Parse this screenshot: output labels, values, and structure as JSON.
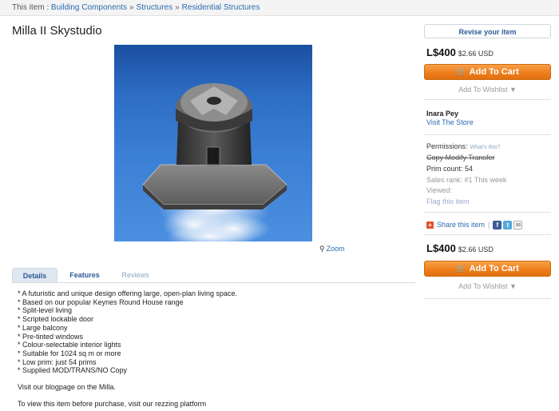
{
  "breadcrumb": {
    "prefix": "This item :",
    "items": [
      "Building Components",
      "Structures",
      "Residential Structures"
    ],
    "separator": "»"
  },
  "product": {
    "title": "Milla II Skystudio",
    "zoom_label": "Zoom"
  },
  "tabs": [
    {
      "label": "Details"
    },
    {
      "label": "Features"
    },
    {
      "label": "Reviews"
    }
  ],
  "details": {
    "bullets": [
      "* A futuristic and unique design offering large, open-plan living space.",
      "* Based on our popular Keynes Round House range",
      "* Split-level living",
      "* Scripted lockable door",
      "* Large balcony",
      "* Pre-tinted windows",
      "* Colour-selectable interior lights",
      "* Suitable for 1024 sq m or more",
      "* Low prim: just 54 prims",
      "* Supplied MOD/TRANS/NO Copy"
    ],
    "para1": "Visit our blogpage on the Milla.",
    "para2": "To view this item before purchase, visit our rezzing platform"
  },
  "sidebar": {
    "revise_label": "Revise your item",
    "price": "L$400",
    "price_usd": "$2.66 USD",
    "add_to_cart": "Add To Cart",
    "add_to_wishlist": "Add To Wishlist ▼",
    "seller": "Inara Pey",
    "visit_store": "Visit The Store",
    "permissions_label": "Permissions:",
    "whats_this": "What's this?",
    "permissions": "Copy Modify Transfer",
    "prim_count": "Prim count: 54",
    "sales_rank": "Sales rank: #1 This week",
    "viewed": "Viewed:",
    "flag": "Flag this item",
    "share": "Share this item"
  },
  "colors": {
    "accent_orange": "#ee7f1d",
    "link_blue": "#2a6bb0"
  }
}
